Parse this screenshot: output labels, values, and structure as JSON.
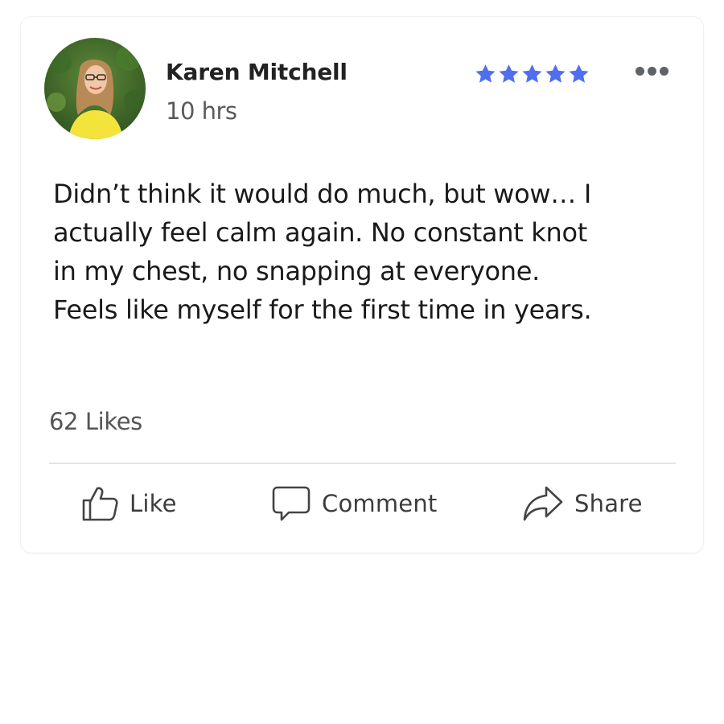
{
  "post": {
    "author_name": "Karen Mitchell",
    "timestamp": "10 hrs",
    "rating": 5,
    "rating_max": 5,
    "rating_color": "#4f6fef",
    "text_lines": [
      "Didn’t think it would do much, but wow… I",
      "actually feel calm again. No constant knot",
      "in my chest, no snapping at everyone.",
      "Feels like myself for the first time in years."
    ],
    "likes_label": "62 Likes",
    "avatar_icon": "profile-photo"
  },
  "actions": {
    "like": {
      "label": "Like",
      "icon": "thumbs-up-icon"
    },
    "comment": {
      "label": "Comment",
      "icon": "speech-bubble-icon"
    },
    "share": {
      "label": "Share",
      "icon": "share-arrow-icon"
    }
  },
  "menu": {
    "icon": "more-options-icon"
  }
}
